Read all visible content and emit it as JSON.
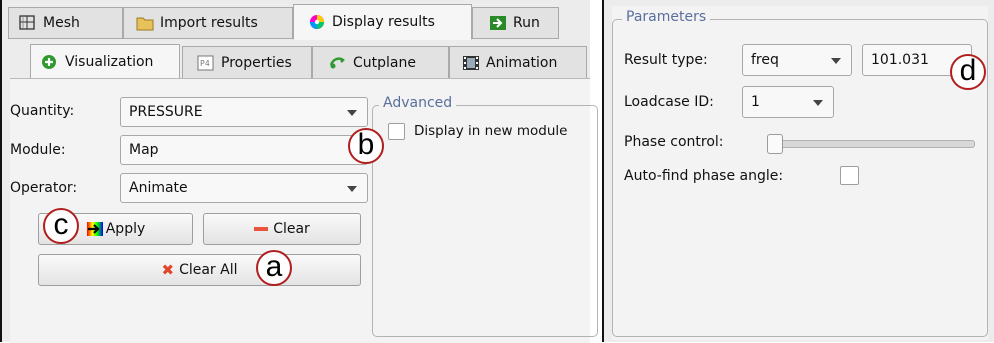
{
  "main_tabs": [
    {
      "label": "Mesh",
      "icon": "mesh-icon"
    },
    {
      "label": "Import results",
      "icon": "folder-icon"
    },
    {
      "label": "Display results",
      "icon": "color-wheel-icon"
    },
    {
      "label": "Run",
      "icon": "run-arrow-icon"
    }
  ],
  "sub_tabs": [
    {
      "label": "Visualization",
      "icon": "add-green-icon"
    },
    {
      "label": "Properties",
      "icon": "properties-icon"
    },
    {
      "label": "Cutplane",
      "icon": "cutplane-icon"
    },
    {
      "label": "Animation",
      "icon": "film-icon"
    }
  ],
  "visualization": {
    "quantity_label": "Quantity:",
    "quantity_value": "PRESSURE",
    "module_label": "Module:",
    "module_value": "Map",
    "operator_label": "Operator:",
    "operator_value": "Animate",
    "apply_label": "Apply",
    "clear_label": "Clear",
    "clear_all_label": "Clear All"
  },
  "advanced": {
    "legend": "Advanced",
    "display_new_module_label": "Display in new module",
    "display_new_module_checked": false
  },
  "parameters": {
    "legend": "Parameters",
    "result_type_label": "Result type:",
    "result_type_value": "freq",
    "frequency_value": "101.031",
    "loadcase_label": "Loadcase ID:",
    "loadcase_value": "1",
    "phase_control_label": "Phase control:",
    "phase_control_level": 0,
    "auto_find_label": "Auto-find phase angle:",
    "auto_find_checked": false
  },
  "callouts": {
    "a": "a",
    "b": "b",
    "c": "c",
    "d": "d"
  },
  "colors": {
    "callout_ring": "#b01e1e",
    "legend_text": "#5a6f9c"
  }
}
